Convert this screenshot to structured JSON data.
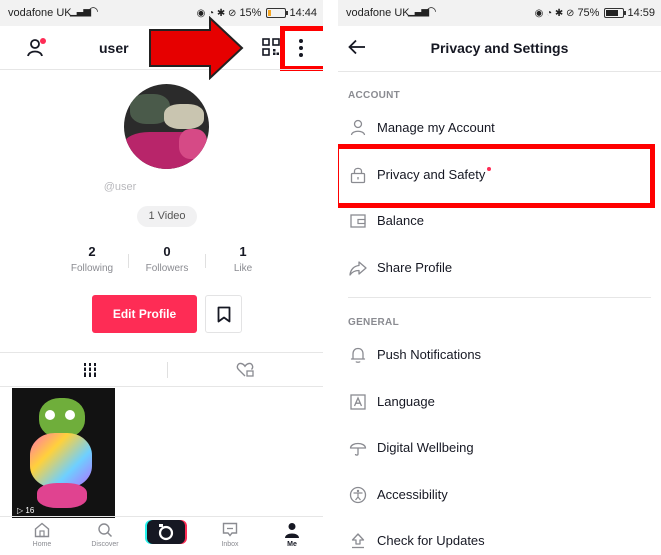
{
  "left_screen": {
    "status": {
      "carrier": "vodafone UK",
      "battery": "15%",
      "time": "14:44"
    },
    "header": {
      "username": "user"
    },
    "handle": "@user",
    "video_badge": "1 Video",
    "stats": [
      {
        "value": "2",
        "label": "Following"
      },
      {
        "value": "0",
        "label": "Followers"
      },
      {
        "value": "1",
        "label": "Like"
      }
    ],
    "edit_profile_label": "Edit Profile",
    "video_views": "16",
    "nav": [
      {
        "label": "Home"
      },
      {
        "label": "Discover"
      },
      {
        "label": ""
      },
      {
        "label": "Inbox"
      },
      {
        "label": "Me"
      }
    ]
  },
  "right_screen": {
    "status": {
      "carrier": "vodafone UK",
      "battery": "75%",
      "time": "14:59"
    },
    "title": "Privacy and Settings",
    "sections": [
      {
        "header": "ACCOUNT",
        "items": [
          {
            "label": "Manage my Account",
            "icon": "person-icon"
          },
          {
            "label": "Privacy and Safety",
            "icon": "lock-icon"
          },
          {
            "label": "Balance",
            "icon": "wallet-icon"
          },
          {
            "label": "Share Profile",
            "icon": "share-icon"
          }
        ]
      },
      {
        "header": "GENERAL",
        "items": [
          {
            "label": "Push Notifications",
            "icon": "bell-icon"
          },
          {
            "label": "Language",
            "icon": "language-icon"
          },
          {
            "label": "Digital Wellbeing",
            "icon": "umbrella-icon"
          },
          {
            "label": "Accessibility",
            "icon": "accessibility-icon"
          },
          {
            "label": "Check for Updates",
            "icon": "update-icon"
          }
        ]
      }
    ]
  },
  "colors": {
    "accent": "#fe2c55",
    "annotation_red": "#ff0000",
    "text_primary": "#161823",
    "text_secondary": "#8a8b91"
  }
}
